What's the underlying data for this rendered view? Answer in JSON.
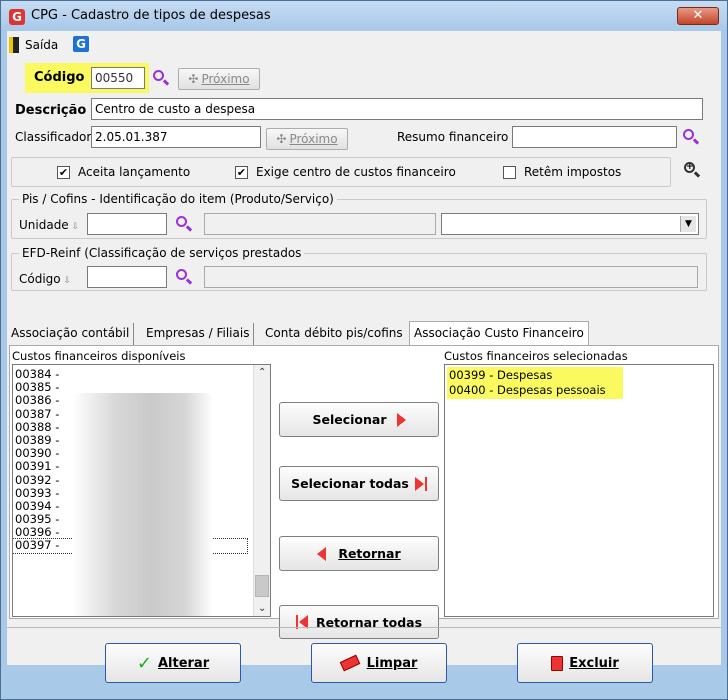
{
  "window": {
    "title": "CPG - Cadastro de tipos de despesas",
    "app_icon_letter": "G",
    "close_symbol": "✕"
  },
  "toolbar": {
    "exit_label": "Saída",
    "g_icon_letter": "G"
  },
  "codigo": {
    "label": "Código",
    "value": "00550",
    "next_label": "Próximo"
  },
  "descricao": {
    "label": "Descrição",
    "value": "Centro de custo a despesa"
  },
  "classificador": {
    "label": "Classificador",
    "value": "2.05.01.387",
    "next_label": "Próximo"
  },
  "resumo": {
    "label": "Resumo financeiro",
    "value": ""
  },
  "checkboxes": [
    {
      "label": "Aceita lançamento",
      "checked": "✔"
    },
    {
      "label": "Exige centro de custos financeiro",
      "checked": "✔"
    },
    {
      "label": "Retêm impostos",
      "checked": ""
    }
  ],
  "pis_group": {
    "title": "Pis / Cofins - Identificação do item (Produto/Serviço)",
    "unidade_label": "Unidade",
    "unidade_value": "",
    "select_value": ""
  },
  "efd_group": {
    "title": "EFD-Reinf (Classificação de serviços prestados",
    "codigo_label": "Código",
    "codigo_value": ""
  },
  "tabs": [
    {
      "label": "Associação contábil"
    },
    {
      "label": "Empresas / Filiais"
    },
    {
      "label": "Conta débito pis/cofins"
    },
    {
      "label": "Associação Custo Financeiro"
    }
  ],
  "available": {
    "title": "Custos financeiros disponíveis",
    "items": [
      "00384 -",
      "00385 -",
      "00386 -",
      "00387 -",
      "00388 -",
      "00389 -",
      "00390 -",
      "00391 -",
      "00392 -",
      "00393 -",
      "00394 -",
      "00395 -",
      "00396 -",
      "00397 -"
    ]
  },
  "selected": {
    "title": "Custos financeiros selecionadas",
    "items": [
      "00399 - Despesas",
      "00400 - Despesas pessoais"
    ]
  },
  "actions": {
    "select": "Selecionar",
    "select_all": "Selecionar todas",
    "back": "Retornar",
    "back_all": "Retornar todas"
  },
  "bottom": {
    "alter": "Alterar",
    "clear": "Limpar",
    "delete": "Excluir"
  },
  "colors": {
    "highlight": "#fafa60",
    "accent_icon": "#9b30d9",
    "arrow": "#ee3333"
  }
}
